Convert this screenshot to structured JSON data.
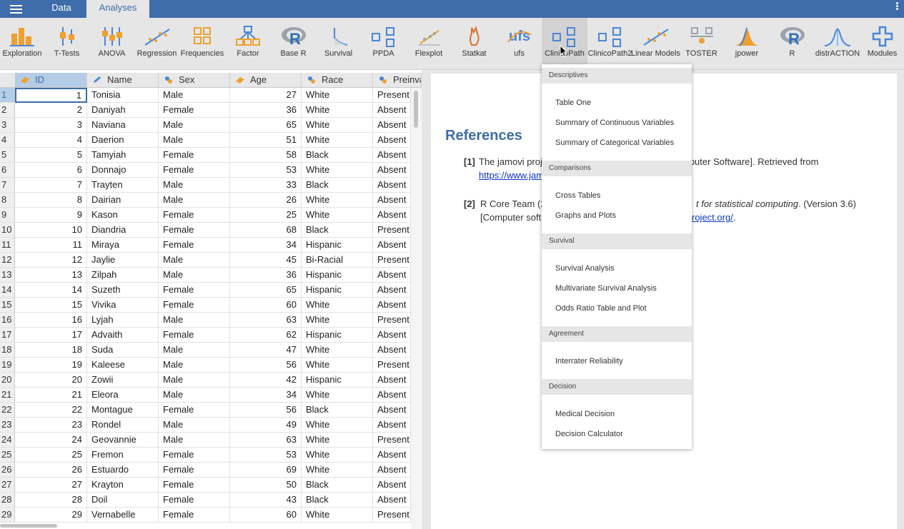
{
  "top_tabs": {
    "data": "Data",
    "analyses": "Analyses"
  },
  "ribbon": [
    {
      "label": "Exploration",
      "icon": "exploration-icon"
    },
    {
      "label": "T-Tests",
      "icon": "ttests-icon"
    },
    {
      "label": "ANOVA",
      "icon": "anova-icon"
    },
    {
      "label": "Regression",
      "icon": "regression-icon"
    },
    {
      "label": "Frequencies",
      "icon": "frequencies-icon"
    },
    {
      "label": "Factor",
      "icon": "factor-icon"
    },
    {
      "label": "Base R",
      "icon": "base-r-icon"
    },
    {
      "label": "Survival",
      "icon": "survival-icon"
    },
    {
      "label": "PPDA",
      "icon": "ppda-icon"
    },
    {
      "label": "Flexplot",
      "icon": "flexplot-icon"
    },
    {
      "label": "Statkat",
      "icon": "statkat-icon"
    },
    {
      "label": "ufs",
      "icon": "ufs-icon"
    },
    {
      "label": "ClinicoPath",
      "icon": "clinicopath-icon"
    },
    {
      "label": "ClinicoPath2",
      "icon": "clinicopath2-icon"
    },
    {
      "label": "Linear Models",
      "icon": "linear-models-icon"
    },
    {
      "label": "TOSTER",
      "icon": "toster-icon"
    },
    {
      "label": "jpower",
      "icon": "jpower-icon"
    },
    {
      "label": "R",
      "icon": "r-icon"
    },
    {
      "label": "distrACTION",
      "icon": "distraction-icon"
    },
    {
      "label": "Modules",
      "icon": "modules-icon"
    }
  ],
  "columns": [
    "ID",
    "Name",
    "Sex",
    "Age",
    "Race",
    "Preinva"
  ],
  "rows": [
    [
      "1",
      "1",
      "Tonisia",
      "Male",
      "27",
      "White",
      "Present"
    ],
    [
      "2",
      "2",
      "Daniyah",
      "Female",
      "36",
      "White",
      "Absent"
    ],
    [
      "3",
      "3",
      "Naviana",
      "Male",
      "65",
      "White",
      "Absent"
    ],
    [
      "4",
      "4",
      "Daerion",
      "Male",
      "51",
      "White",
      "Absent"
    ],
    [
      "5",
      "5",
      "Tamyiah",
      "Female",
      "58",
      "Black",
      "Absent"
    ],
    [
      "6",
      "6",
      "Donnajo",
      "Female",
      "53",
      "White",
      "Absent"
    ],
    [
      "7",
      "7",
      "Trayten",
      "Male",
      "33",
      "Black",
      "Absent"
    ],
    [
      "8",
      "8",
      "Dairian",
      "Male",
      "26",
      "White",
      "Absent"
    ],
    [
      "9",
      "9",
      "Kason",
      "Female",
      "25",
      "White",
      "Absent"
    ],
    [
      "10",
      "10",
      "Diandria",
      "Female",
      "68",
      "Black",
      "Present"
    ],
    [
      "11",
      "11",
      "Miraya",
      "Female",
      "34",
      "Hispanic",
      "Absent"
    ],
    [
      "12",
      "12",
      "Jaylie",
      "Male",
      "45",
      "Bi-Racial",
      "Present"
    ],
    [
      "13",
      "13",
      "Zilpah",
      "Male",
      "36",
      "Hispanic",
      "Absent"
    ],
    [
      "14",
      "14",
      "Suzeth",
      "Female",
      "65",
      "Hispanic",
      "Absent"
    ],
    [
      "15",
      "15",
      "Vivika",
      "Female",
      "60",
      "White",
      "Absent"
    ],
    [
      "16",
      "16",
      "Lyjah",
      "Male",
      "63",
      "White",
      "Present"
    ],
    [
      "17",
      "17",
      "Advaith",
      "Female",
      "62",
      "Hispanic",
      "Absent"
    ],
    [
      "18",
      "18",
      "Suda",
      "Male",
      "47",
      "White",
      "Absent"
    ],
    [
      "19",
      "19",
      "Kaleese",
      "Male",
      "56",
      "White",
      "Present"
    ],
    [
      "20",
      "20",
      "Zowii",
      "Male",
      "42",
      "Hispanic",
      "Absent"
    ],
    [
      "21",
      "21",
      "Eleora",
      "Male",
      "34",
      "White",
      "Absent"
    ],
    [
      "22",
      "22",
      "Montague",
      "Female",
      "56",
      "Black",
      "Absent"
    ],
    [
      "23",
      "23",
      "Rondel",
      "Male",
      "49",
      "White",
      "Absent"
    ],
    [
      "24",
      "24",
      "Geovannie",
      "Male",
      "63",
      "White",
      "Present"
    ],
    [
      "25",
      "25",
      "Fremon",
      "Female",
      "53",
      "White",
      "Absent"
    ],
    [
      "26",
      "26",
      "Estuardo",
      "Female",
      "69",
      "White",
      "Absent"
    ],
    [
      "27",
      "27",
      "Krayton",
      "Female",
      "50",
      "Black",
      "Absent"
    ],
    [
      "28",
      "28",
      "Doil",
      "Female",
      "43",
      "Black",
      "Absent"
    ],
    [
      "29",
      "29",
      "Vernabelle",
      "Female",
      "60",
      "White",
      "Present"
    ]
  ],
  "results": {
    "title": "References",
    "refs": [
      {
        "num": "[1]",
        "line1": "The jamovi proj",
        "line1_tail": "mputer Software]. Retrieved from",
        "link": "https://www.jam"
      },
      {
        "num": "[2]",
        "line1": "R Core Team (2",
        "line1_italic": "t for statistical computing",
        "line1_tail": ". (Version 3.6)",
        "line2": "[Computer soft",
        "link2": "roject.org/",
        "line2_tail": "."
      }
    ]
  },
  "dropdown": {
    "sections": [
      {
        "title": "Descriptives",
        "items": [
          "Table One",
          "Summary of Continuous Variables",
          "Summary of Categorical Variables"
        ]
      },
      {
        "title": "Comparisons",
        "items": [
          "Cross Tables",
          "Graphs and Plots"
        ]
      },
      {
        "title": "Survival",
        "items": [
          "Survival Analysis",
          "Multivariate Survival Analysis",
          "Odds Ratio Table and Plot"
        ]
      },
      {
        "title": "Agreement",
        "items": [
          "Interrater Reliability"
        ]
      },
      {
        "title": "Decision",
        "items": [
          "Medical Decision",
          "Decision Calculator"
        ]
      }
    ]
  },
  "colors": {
    "accent": "#3e6da9",
    "icon_blue": "#4a86d6",
    "icon_orange": "#f0a030"
  }
}
